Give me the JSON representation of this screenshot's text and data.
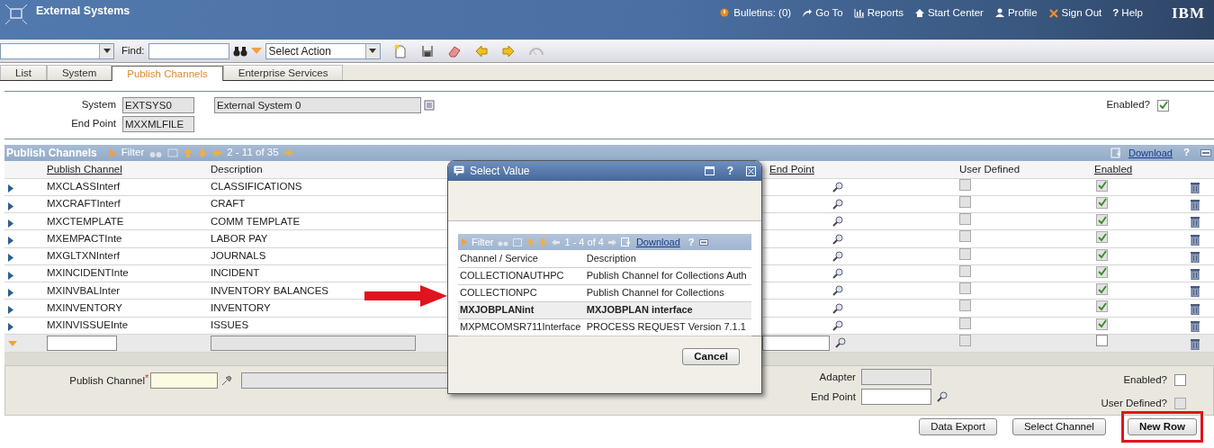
{
  "header": {
    "title": "External Systems",
    "links": [
      {
        "kind": "bulletins",
        "label": "Bulletins: (0)"
      },
      {
        "kind": "goto",
        "label": "Go To"
      },
      {
        "kind": "reports",
        "label": "Reports"
      },
      {
        "kind": "start",
        "label": "Start Center"
      },
      {
        "kind": "profile",
        "label": "Profile"
      },
      {
        "kind": "signout",
        "label": "Sign Out"
      },
      {
        "kind": "help",
        "label": "Help"
      }
    ],
    "help_mark": "?",
    "logo": "IBM"
  },
  "toolbar": {
    "find_label": "Find:",
    "action_select": "Select Action"
  },
  "tabs": [
    {
      "label": "List",
      "selected": false
    },
    {
      "label": "System",
      "selected": false
    },
    {
      "label": "Publish Channels",
      "selected": true
    },
    {
      "label": "Enterprise Services",
      "selected": false
    }
  ],
  "system_form": {
    "system_label": "System",
    "system_value": "EXTSYS0",
    "description_value": "External System 0",
    "end_point_label": "End Point",
    "end_point_value": "MXXMLFILE",
    "enabled_label": "Enabled?",
    "enabled": true
  },
  "table": {
    "title": "Publish Channels",
    "filter": "Filter",
    "pager": "2 - 11 of 35",
    "download": "Download",
    "help_mark": "?",
    "columns": [
      "Publish Channel",
      "Description",
      "End Point",
      "User Defined",
      "Enabled"
    ],
    "rows": [
      {
        "channel": "MXCLASSInterf",
        "description": "CLASSIFICATIONS",
        "user_defined": false,
        "enabled": true
      },
      {
        "channel": "MXCRAFTInterf",
        "description": "CRAFT",
        "user_defined": false,
        "enabled": true
      },
      {
        "channel": "MXCTEMPLATE",
        "description": "COMM TEMPLATE",
        "user_defined": false,
        "enabled": true
      },
      {
        "channel": "MXEMPACTInte",
        "description": "LABOR PAY",
        "user_defined": false,
        "enabled": true
      },
      {
        "channel": "MXGLTXNInterf",
        "description": "JOURNALS",
        "user_defined": false,
        "enabled": true
      },
      {
        "channel": "MXINCIDENTInte",
        "description": "INCIDENT",
        "user_defined": false,
        "enabled": true
      },
      {
        "channel": "MXINVBALInter",
        "description": "INVENTORY BALANCES",
        "user_defined": false,
        "enabled": true
      },
      {
        "channel": "MXINVENTORY",
        "description": "INVENTORY",
        "user_defined": false,
        "enabled": true
      },
      {
        "channel": "MXINVISSUEInte",
        "description": "ISSUES",
        "user_defined": false,
        "enabled": true
      }
    ],
    "new_row": {
      "user_defined": false,
      "enabled": false
    }
  },
  "detail": {
    "publish_channel_label": "Publish Channel",
    "required_mark": "*",
    "adapter_label": "Adapter",
    "end_point_label": "End Point",
    "enabled_label": "Enabled?",
    "enabled": false,
    "user_defined_label": "User Defined?",
    "user_defined": false
  },
  "buttons": [
    {
      "label": "Data Export",
      "highlighted": false
    },
    {
      "label": "Select Channel",
      "highlighted": false
    },
    {
      "label": "New Row",
      "highlighted": true
    }
  ],
  "dialog": {
    "title": "Select Value",
    "help_mark": "?",
    "filter": "Filter",
    "pager": "1 - 4 of 4",
    "download": "Download",
    "columns": [
      "Channel / Service",
      "Description"
    ],
    "rows": [
      {
        "channel": "COLLECTIONAUTHPC",
        "description": "Publish Channel for Collections Auth",
        "selected": false
      },
      {
        "channel": "COLLECTIONPC",
        "description": "Publish Channel for Collections",
        "selected": false
      },
      {
        "channel": "MXJOBPLANint",
        "description": "MXJOBPLAN interface",
        "selected": true
      },
      {
        "channel": "MXPMCOMSR711Interface",
        "description": "PROCESS REQUEST Version 7.1.1",
        "selected": false
      }
    ],
    "cancel": "Cancel"
  }
}
